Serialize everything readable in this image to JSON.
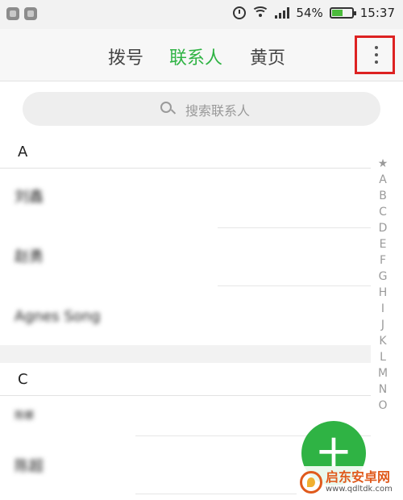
{
  "status": {
    "battery": "54%",
    "battery_level": 0.54,
    "time": "15:37"
  },
  "tabs": {
    "dial": "拨号",
    "contacts": "联系人",
    "yellow_pages": "黄页",
    "active": "contacts"
  },
  "search": {
    "placeholder": "搜索联系人"
  },
  "sections": [
    {
      "letter": "A",
      "contacts": [
        "刘鑫",
        "赵勇",
        "Agnes Song"
      ]
    },
    {
      "letter": "C",
      "contacts": [
        "陈娜",
        "陈超"
      ]
    }
  ],
  "index_letters": [
    "★",
    "A",
    "B",
    "C",
    "D",
    "E",
    "F",
    "G",
    "H",
    "I",
    "J",
    "K",
    "L",
    "M",
    "N",
    "O"
  ],
  "fab": {
    "label": "+"
  },
  "watermark": {
    "title": "启东安卓网",
    "url": "www.qdltdk.com"
  },
  "colors": {
    "accent": "#2fb344",
    "highlight_box": "#dd2222"
  },
  "icons": [
    "search-icon",
    "alarm-icon",
    "wifi-icon",
    "signal-icon",
    "battery-icon",
    "more-vert-icon",
    "add-icon"
  ]
}
